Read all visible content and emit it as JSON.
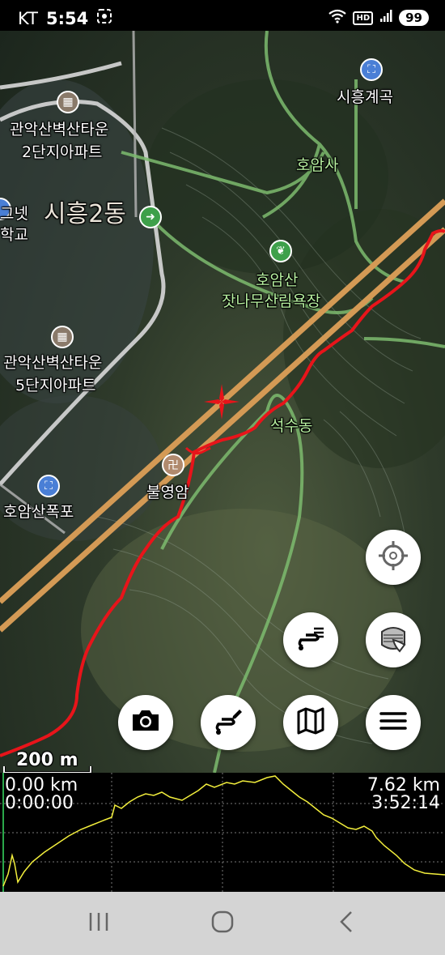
{
  "status_bar": {
    "carrier": "KT",
    "time": "5:54",
    "battery": "99",
    "hd": "HD"
  },
  "map": {
    "labels": {
      "siheung_gyegok": "시흥계곡",
      "apt_2danji_1": "관악산벽산타운",
      "apt_2danji_2": "2단지아파트",
      "hoamsa": "호암사",
      "school_1": "그넷",
      "school_2": "학교",
      "siheung_2dong": "시흥2동",
      "hoamsan_1": "호암산",
      "hoamsan_2": "잣나무산림욕장",
      "apt_5danji_1": "관악산벽산타운",
      "apt_5danji_2": "5단지아파트",
      "seoksudong": "석수동",
      "bulyeongam": "불영암",
      "hoamsan_pokpo": "호암산폭포"
    },
    "scale": "200 m"
  },
  "elevation": {
    "start_distance": "0.00 km",
    "start_time": "0:00:00",
    "total_distance": "7.62 km",
    "total_time": "3:52:14"
  },
  "icons": {
    "locate": "crosshair-icon",
    "layers": "layers-icon",
    "route": "route-icon",
    "camera": "camera-icon",
    "draw_route": "draw-route-icon",
    "map": "map-icon",
    "menu": "menu-icon"
  },
  "colors": {
    "track": "#e8141a",
    "highway": "#d49a55",
    "trail": "#7dbb6e",
    "elevation_line": "#f2ee3c",
    "fab_bg": "#ffffff"
  }
}
